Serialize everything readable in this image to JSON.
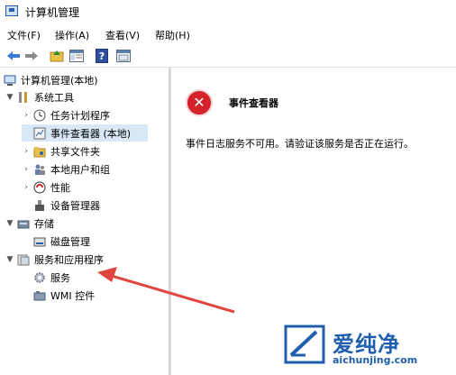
{
  "window": {
    "title": "计算机管理"
  },
  "menu": [
    "文件(F)",
    "操作(A)",
    "查看(V)",
    "帮助(H)"
  ],
  "toolbar": {
    "icons": [
      "back-arrow-icon",
      "forward-arrow-icon",
      "up-folder-icon",
      "show-hide-tree-icon",
      "help-icon",
      "properties-icon"
    ]
  },
  "tree": {
    "root": "计算机管理(本地)",
    "system_tools": "系统工具",
    "task_scheduler": "任务计划程序",
    "event_viewer": "事件查看器 (本地)",
    "shared_folders": "共享文件夹",
    "local_users": "本地用户和组",
    "performance": "性能",
    "device_manager": "设备管理器",
    "storage": "存储",
    "disk_management": "磁盘管理",
    "services_apps": "服务和应用程序",
    "services": "服务",
    "wmi": "WMI 控件"
  },
  "detail": {
    "title": "事件查看器",
    "message": "事件日志服务不可用。请验证该服务是否正在运行。",
    "icon_glyph": "✕"
  },
  "watermark": {
    "text": "爱纯净",
    "url": "aichunjing.com"
  },
  "colors": {
    "selection": "#d9e8f7",
    "error": "#d3222a",
    "arrow": "#e0453e",
    "brand": "#1f5fae"
  }
}
